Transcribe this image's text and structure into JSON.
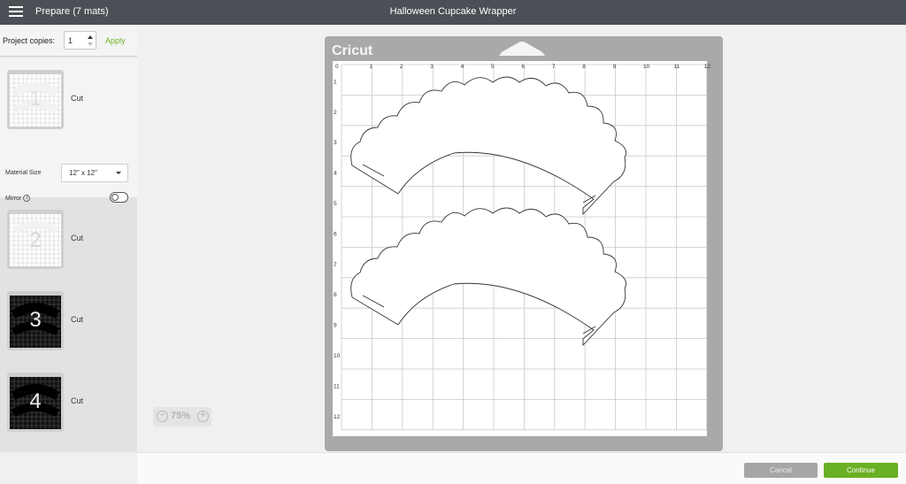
{
  "header": {
    "prepare_title": "Prepare (7 mats)",
    "project_title": "Halloween Cupcake Wrapper",
    "menu_icon": "hamburger-menu-icon"
  },
  "copies": {
    "label": "Project copies:",
    "value": "1",
    "apply_label": "Apply"
  },
  "mats": [
    {
      "number": "1",
      "label": "Cut",
      "selected": true,
      "material": "white"
    },
    {
      "number": "2",
      "label": "Cut",
      "selected": false,
      "material": "white"
    },
    {
      "number": "3",
      "label": "Cut",
      "selected": false,
      "material": "black"
    },
    {
      "number": "4",
      "label": "Cut",
      "selected": false,
      "material": "black"
    }
  ],
  "settings": {
    "material_size_label": "Material Size",
    "material_size_value": "12\" x 12\"",
    "mirror_label": "Mirror",
    "mirror_info": "i",
    "mirror_on": false
  },
  "canvas": {
    "logo": "Cricut",
    "ruler_top": [
      "0",
      "1",
      "2",
      "3",
      "4",
      "5",
      "6",
      "7",
      "8",
      "9",
      "10",
      "11",
      "12"
    ],
    "ruler_left": [
      "1",
      "2",
      "3",
      "4",
      "5",
      "6",
      "7",
      "8",
      "9",
      "10",
      "11",
      "12"
    ],
    "zoom_minus": "−",
    "zoom_value": "75%",
    "zoom_plus": "+"
  },
  "footer": {
    "cancel_label": "Cancel",
    "continue_label": "Continue"
  },
  "colors": {
    "topbar": "#4a5055",
    "accent_green": "#6ab023",
    "mat_gray": "#a9a9a9"
  }
}
